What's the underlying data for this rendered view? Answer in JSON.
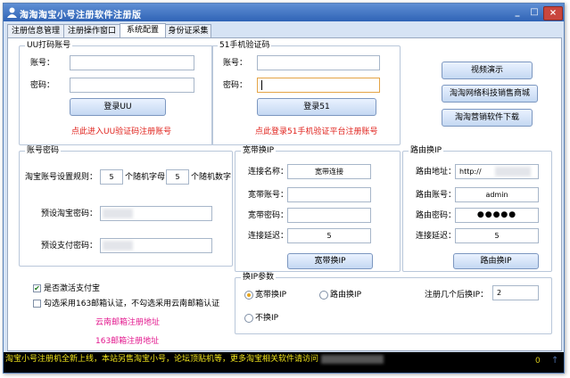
{
  "window": {
    "title": "淘淘淘宝小号注册软件注册版",
    "min_label": "_",
    "max_label": "□",
    "close_label": "×"
  },
  "tabs": [
    "注册信息管理",
    "注册操作窗口",
    "系统配置",
    "身份证采集"
  ],
  "uu": {
    "group_title": "UU打码账号",
    "account_label": "账号：",
    "password_label": "密码：",
    "login_button": "登录UU",
    "register_link": "点此进入UU验证码注册账号"
  },
  "s51": {
    "group_title": "51手机验证码",
    "account_label": "账号：",
    "password_label": "密码：",
    "login_button": "登录51",
    "register_link": "点此登录51手机验证平台注册账号"
  },
  "right_buttons": [
    "视频演示",
    "淘淘网络科技销售商城",
    "淘淘营销软件下载"
  ],
  "account_pwd": {
    "group_title": "账号密码",
    "rule_label": "淘宝账号设置规则：",
    "letters_value": "5",
    "letters_label": "个随机字母",
    "digits_value": "5",
    "digits_label": "个随机数字",
    "login_pwd_label": "预设淘宝密码：",
    "pay_pwd_label": "预设支付密码："
  },
  "broadband": {
    "group_title": "宽带换IP",
    "conn_name_label": "连接名称：",
    "conn_name_value": "宽带连接",
    "account_label": "宽带账号：",
    "password_label": "宽带密码：",
    "delay_label": "连接延迟：",
    "delay_value": "5",
    "button": "宽带换IP"
  },
  "router": {
    "group_title": "路由换IP",
    "address_label": "路由地址：",
    "address_value": "http://",
    "account_label": "路由账号：",
    "account_value": "admin",
    "password_label": "路由密码：",
    "password_value": "●●●●●",
    "delay_label": "连接延迟：",
    "delay_value": "5",
    "button": "路由换IP"
  },
  "options": {
    "activate_alipay": "是否激活支付宝",
    "activate_alipay_checked": true,
    "mail_option": "勾选采用163邮箱认证，不勾选采用云南邮箱认证",
    "mail_option_checked": false,
    "yunnan_link": "云南邮箱注册地址",
    "mail163_link": "163邮箱注册地址"
  },
  "ip_params": {
    "group_title": "换IP参数",
    "radio_broadband": "宽带换IP",
    "radio_router": "路由换IP",
    "radio_none": "不换IP",
    "selected": "宽带换IP",
    "after_label": "注册几个后换IP：",
    "after_value": "2"
  },
  "status_bar": {
    "marquee": "淘宝小号注册机全新上线，本站另售淘宝小号，论坛顶贴机等，更多淘宝相关软件请访问",
    "right_text": "0",
    "arrow": "↑"
  },
  "colors": {
    "title_bar": "#2f63b6",
    "link_red": "#e0211b",
    "link_pink": "#e3188e",
    "marquee_text": "#f0e41c"
  }
}
